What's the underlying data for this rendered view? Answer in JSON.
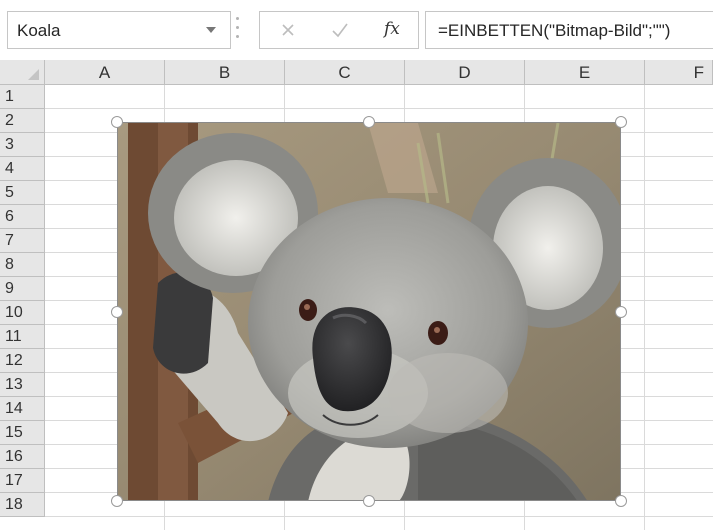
{
  "formula_bar": {
    "name_box_value": "Koala",
    "cancel_icon": "cancel-x-icon",
    "enter_icon": "checkmark-icon",
    "function_label": "fx",
    "formula": "=EINBETTEN(\"Bitmap-Bild\";\"\")"
  },
  "columns": [
    "A",
    "B",
    "C",
    "D",
    "E",
    "F"
  ],
  "rows": [
    "1",
    "2",
    "3",
    "4",
    "5",
    "6",
    "7",
    "8",
    "9",
    "10",
    "11",
    "12",
    "13",
    "14",
    "15",
    "16",
    "17",
    "18"
  ],
  "picture": {
    "subject": "koala-photo",
    "colors": {
      "background": "#9a8a70",
      "fur_light": "#d8d8d4",
      "fur_dark": "#6e6e6c",
      "nose": "#2c2c2e"
    }
  }
}
